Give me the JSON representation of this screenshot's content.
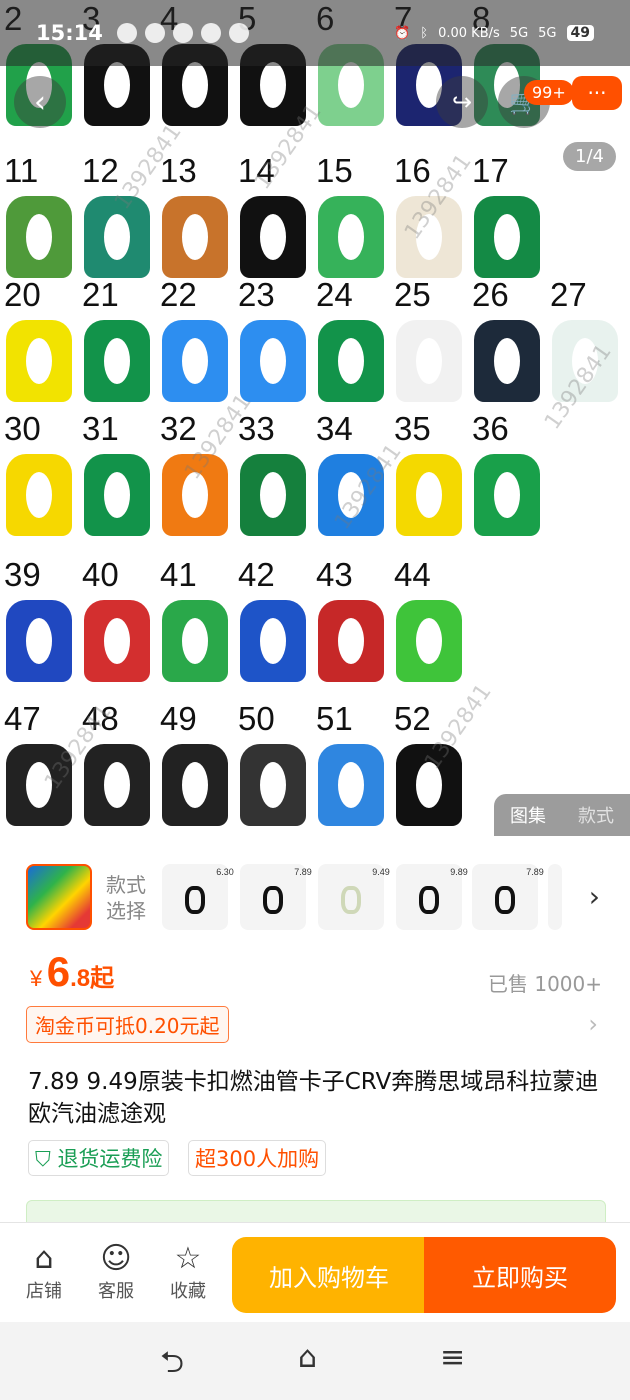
{
  "status_bar": {
    "time": "15:14",
    "network_speed": "0.00 KB/s",
    "signal_1": "5G",
    "signal_2": "5G",
    "battery": "49"
  },
  "top_nav": {
    "cart_badge": "99+",
    "more_label": "···",
    "image_index": "1/4"
  },
  "gallery": {
    "rows": [
      {
        "labels": [
          "2",
          "3",
          "4",
          "5",
          "6",
          "7",
          "8"
        ],
        "colors": [
          "#21a14a",
          "#111111",
          "#111111",
          "#111111",
          "#7ed08e",
          "#1c2570",
          "#2e8b57"
        ]
      },
      {
        "labels": [
          "11",
          "12",
          "13",
          "14",
          "15",
          "16",
          "17"
        ],
        "colors": [
          "#4f9a3a",
          "#1f8a70",
          "#c8732b",
          "#111111",
          "#36b25a",
          "#eee6d6",
          "#148a45"
        ]
      },
      {
        "labels": [
          "20",
          "21",
          "22",
          "23",
          "24",
          "25",
          "26",
          "27"
        ],
        "colors": [
          "#f2e300",
          "#12934a",
          "#2d8ef0",
          "#2d8ef0",
          "#12934a",
          "#f1f1f1",
          "#1d2a3a",
          "#e8f2ee"
        ]
      },
      {
        "labels": [
          "30",
          "31",
          "32",
          "33",
          "34",
          "35",
          "36"
        ],
        "colors": [
          "#f6d800",
          "#12934a",
          "#f07a12",
          "#15803d",
          "#1f7fe0",
          "#f4d900",
          "#19a04a"
        ]
      },
      {
        "labels": [
          "39",
          "40",
          "41",
          "42",
          "43",
          "44"
        ],
        "colors": [
          "#2048c0",
          "#d32f2f",
          "#2aa84a",
          "#1e54c8",
          "#c62828",
          "#3fc43a"
        ]
      },
      {
        "labels": [
          "47",
          "48",
          "49",
          "50",
          "51",
          "52"
        ],
        "colors": [
          "#222222",
          "#222222",
          "#222222",
          "#333333",
          "#2f86e0",
          "#111111"
        ]
      }
    ],
    "watermark": "1392841",
    "album_label": "图集",
    "style_label": "款式"
  },
  "variants": {
    "label_line1": "款式",
    "label_line2": "选择",
    "thumbs": [
      {
        "price": "6.30"
      },
      {
        "price": "7.89"
      },
      {
        "price": "9.49"
      },
      {
        "price": "9.89"
      },
      {
        "price": "7.89"
      }
    ]
  },
  "product": {
    "currency": "¥",
    "price_int": "6",
    "price_dec": ".8起",
    "sold": "已售 1000+",
    "coin_deduct": "淘金币可抵0.20元起",
    "title": "7.89 9.49原装卡扣燃油管卡子CRV奔腾思域昂科拉蒙迪欧汽油滤途观",
    "tag_return": "退货运费险",
    "tag_popular": "超300人加购"
  },
  "bottom_bar": {
    "shop": "店铺",
    "service": "客服",
    "favorite": "收藏",
    "add_to_cart": "加入购物车",
    "buy_now": "立即购买"
  },
  "colors": {
    "accent": "#ff5000",
    "cart_button": "#ffb300",
    "buy_button": "#ff5a00",
    "green": "#1a9e55"
  }
}
